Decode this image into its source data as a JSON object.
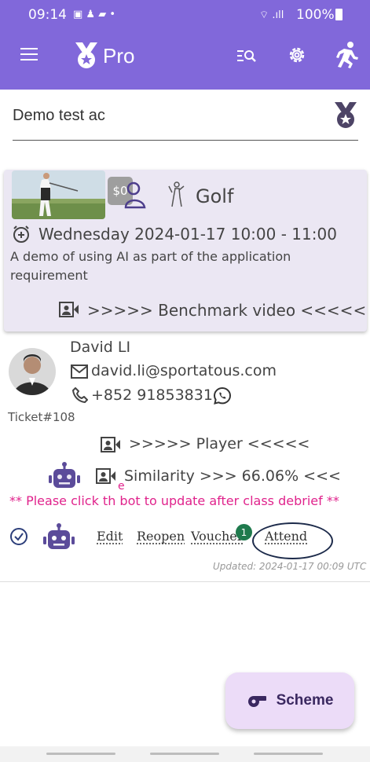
{
  "status_bar": {
    "time": "09:14",
    "battery": "100%"
  },
  "app_bar": {
    "title": "Pro"
  },
  "search": {
    "value": "Demo test ac"
  },
  "class_card": {
    "price": "$0",
    "sport": "Golf",
    "datetime": "Wednesday 2024-01-17 10:00 - 11:00",
    "description": "A demo of using AI as part of the application requirement",
    "benchmark_link": ">>>>> Benchmark video <<<<<"
  },
  "student": {
    "name": "David LI",
    "email": "david.li@sportatous.com",
    "phone": "+852 91853831",
    "ticket": "Ticket#108",
    "player_link": ">>>>> Player <<<<<",
    "similarity": "Similarity >>> 66.06% <<<",
    "similarity_prefix": "e",
    "warning": "** Please click th   bot to update after class debrief **"
  },
  "actions": {
    "edit": "Edit",
    "reopen": "Reopen",
    "voucher": "Voucher",
    "voucher_count": "1",
    "attend": "Attend"
  },
  "updated": "Updated: 2024-01-17 00:09 UTC",
  "fab": {
    "label": "Scheme"
  },
  "colors": {
    "app_bar": "#8168da",
    "card_bg": "#ebe7f3",
    "icon_purple": "#5b4b9a",
    "warning": "#e0238c",
    "badge_green": "#1f7a4d",
    "fab_bg": "#ecdcf8"
  },
  "icons": [
    "menu-icon",
    "medal-icon",
    "search-list-icon",
    "settings-icon",
    "running-icon",
    "clock-plus-icon",
    "person-icon",
    "golfer-icon",
    "video-icon",
    "email-icon",
    "phone-icon",
    "whatsapp-icon",
    "robot-icon",
    "check-circle-icon",
    "whistle-icon"
  ]
}
